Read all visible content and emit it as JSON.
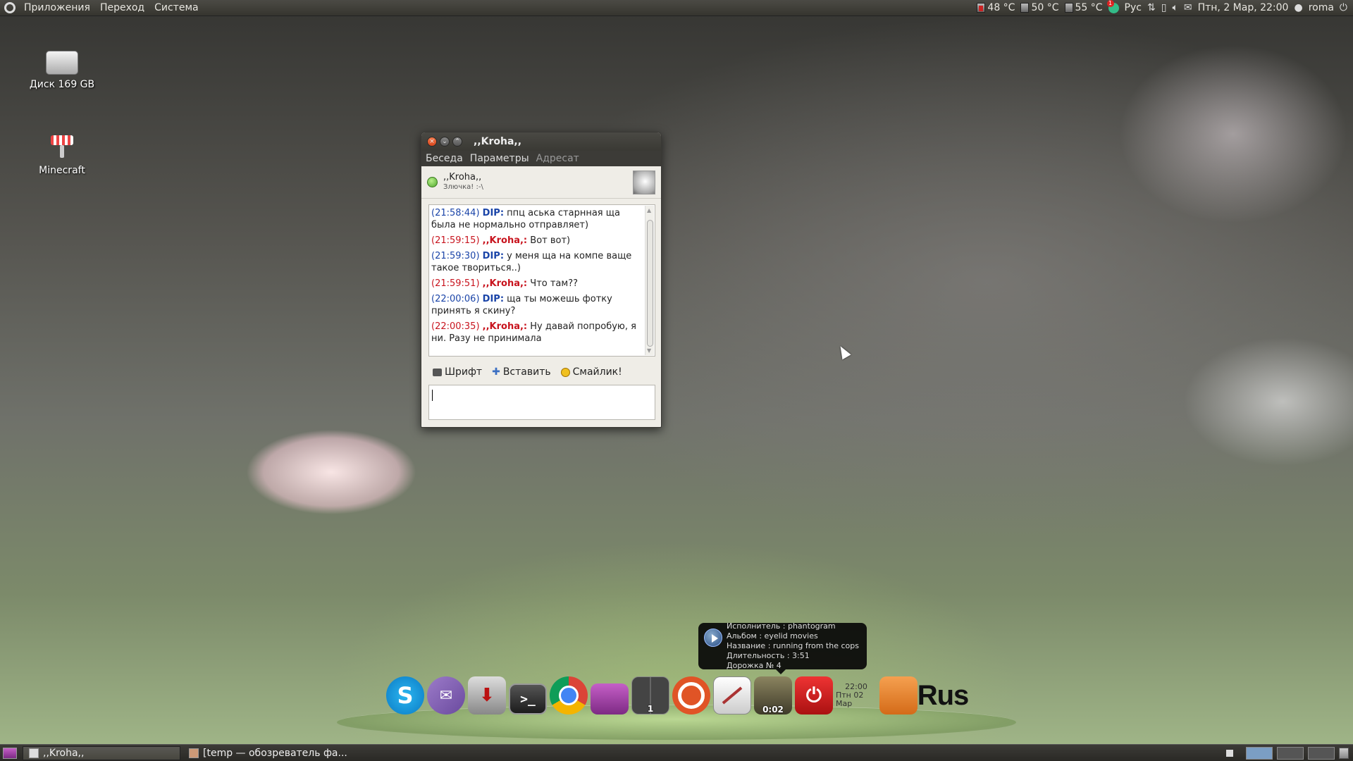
{
  "top_panel": {
    "menus": [
      "Приложения",
      "Переход",
      "Система"
    ],
    "sensors": [
      "48 °C",
      "50 °C",
      "55 °C"
    ],
    "keyboard_layout": "Рус",
    "datetime": "Птн, 2 Мар, 22:00",
    "user": "roma"
  },
  "desktop": {
    "icons": [
      {
        "label": "Диск 169 GB",
        "icon": "hard-disk-icon"
      },
      {
        "label": "Minecraft",
        "icon": "minecraft-icon"
      }
    ]
  },
  "chat_window": {
    "title": ",,Kroha,,",
    "menus": {
      "conversation": "Беседа",
      "options": "Параметры",
      "addressee": "Адресат"
    },
    "contact": {
      "name": ",,Kroha,,",
      "mood": "Злючка!  :-\\",
      "status_color": "#5cc03a"
    },
    "messages": [
      {
        "time": "(21:58:44)",
        "nick": "DIP:",
        "text": "ппц аська старнная ща была не нормально отправляет)",
        "who": "dip"
      },
      {
        "time": "(21:59:15)",
        "nick": ",,Kroha,:",
        "text": "Вот вот)",
        "who": "kroha"
      },
      {
        "time": "(21:59:30)",
        "nick": "DIP:",
        "text": "у меня ща на компе ваще такое твориться..)",
        "who": "dip"
      },
      {
        "time": "(21:59:51)",
        "nick": ",,Kroha,:",
        "text": "Что там??",
        "who": "kroha"
      },
      {
        "time": "(22:00:06)",
        "nick": "DIP:",
        "text": "ща   ты можешь фотку принять я скину?",
        "who": "dip"
      },
      {
        "time": "(22:00:35)",
        "nick": ",,Kroha,:",
        "text": "Ну давай попробую, я ни. Разу не принимала",
        "who": "kroha"
      }
    ],
    "toolbar": {
      "font": "Шрифт",
      "insert": "Вставить",
      "smiley": "Смайлик!"
    },
    "input_value": ""
  },
  "now_playing_tooltip": {
    "artist": "Исполнитель : phantogram",
    "album": "Альбом : eyelid movies",
    "track": "Название : running from the cops",
    "duration": "Длительность : 3:51",
    "track_no": "Дорожка № 4"
  },
  "dock": {
    "desktop_switcher_number": "1",
    "media_elapsed": "0:02",
    "clock_time": "22:00",
    "clock_date": "Птн 02 Мар",
    "lang": "Rus"
  },
  "bottom_panel": {
    "tasks": [
      ",,Kroha,,",
      "[temp — обозреватель фа..."
    ]
  },
  "colors": {
    "dip": "#1a44a8",
    "kroha": "#c8141e"
  }
}
